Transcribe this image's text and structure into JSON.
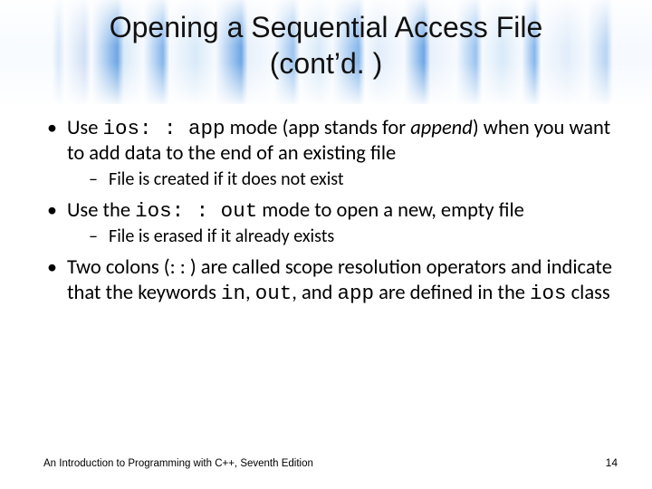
{
  "title_line1": "Opening a Sequential Access File",
  "title_line2": "(cont’d. )",
  "bullets": {
    "b1_pre": "Use ",
    "b1_code": "ios: : app",
    "b1_mid": " mode (app stands for ",
    "b1_em": "append",
    "b1_post": ") when you want to add data to the end of an existing file",
    "b1_sub1": "File is created if it does not exist",
    "b2_pre": "Use the ",
    "b2_code": "ios: : out",
    "b2_post": " mode to open a new, empty file",
    "b2_sub1": "File is erased if it already exists",
    "b3_pre": "Two colons (: : ) are called scope resolution operators and indicate that the keywords ",
    "b3_code1": "in",
    "b3_mid1": ", ",
    "b3_code2": "out",
    "b3_mid2": ", and ",
    "b3_code3": "app",
    "b3_mid3": " are defined in the ",
    "b3_code4": "ios",
    "b3_post": " class"
  },
  "footer_left": "An Introduction to Programming with C++, Seventh Edition",
  "footer_right": "14"
}
